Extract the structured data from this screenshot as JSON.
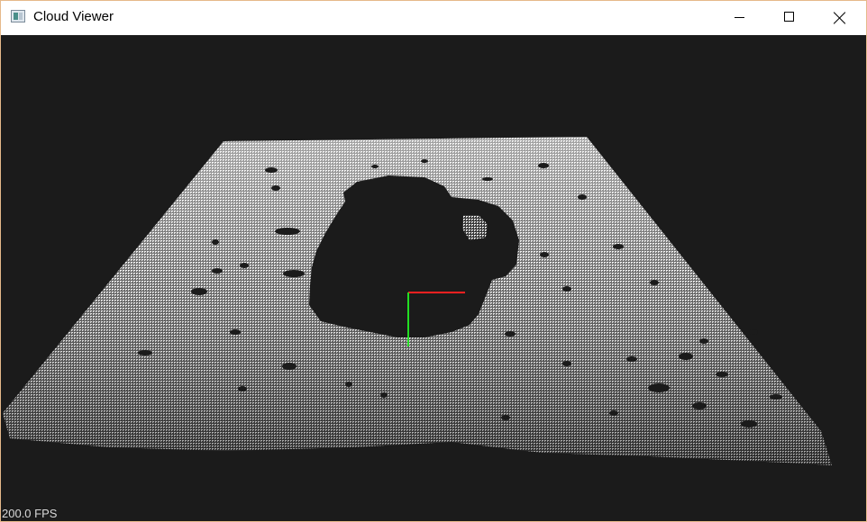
{
  "window": {
    "title": "Cloud Viewer",
    "controls": {
      "minimize": "minimize-icon",
      "maximize": "maximize-icon",
      "close": "close-icon"
    }
  },
  "viewport": {
    "background_color": "#1b1b1b",
    "point_color": "#ffffff",
    "fps_label": "200.0 FPS",
    "axes": {
      "x_color": "#ff2020",
      "y_color": "#22dd22"
    }
  }
}
